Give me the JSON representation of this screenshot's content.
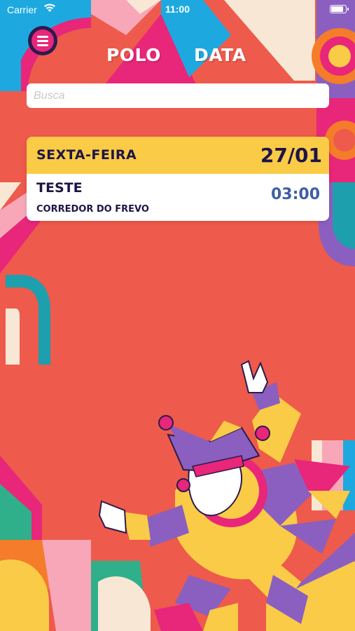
{
  "status_bar": {
    "carrier": "Carrier",
    "time": "11:00",
    "battery_level": 0.95
  },
  "header": {
    "title_left": "POLO",
    "title_right": "DATA"
  },
  "search": {
    "placeholder": "Busca",
    "value": ""
  },
  "events": [
    {
      "weekday": "SEXTA-FEIRA",
      "date": "27/01",
      "title": "TESTE",
      "place": "CORREDOR DO FREVO",
      "time": "03:00"
    }
  ],
  "colors": {
    "background": "#EE5A4B",
    "card_header": "#F9CB46",
    "card_text": "#1F1446",
    "time_text": "#3E5FA6",
    "menu_button": "#E8267A"
  }
}
